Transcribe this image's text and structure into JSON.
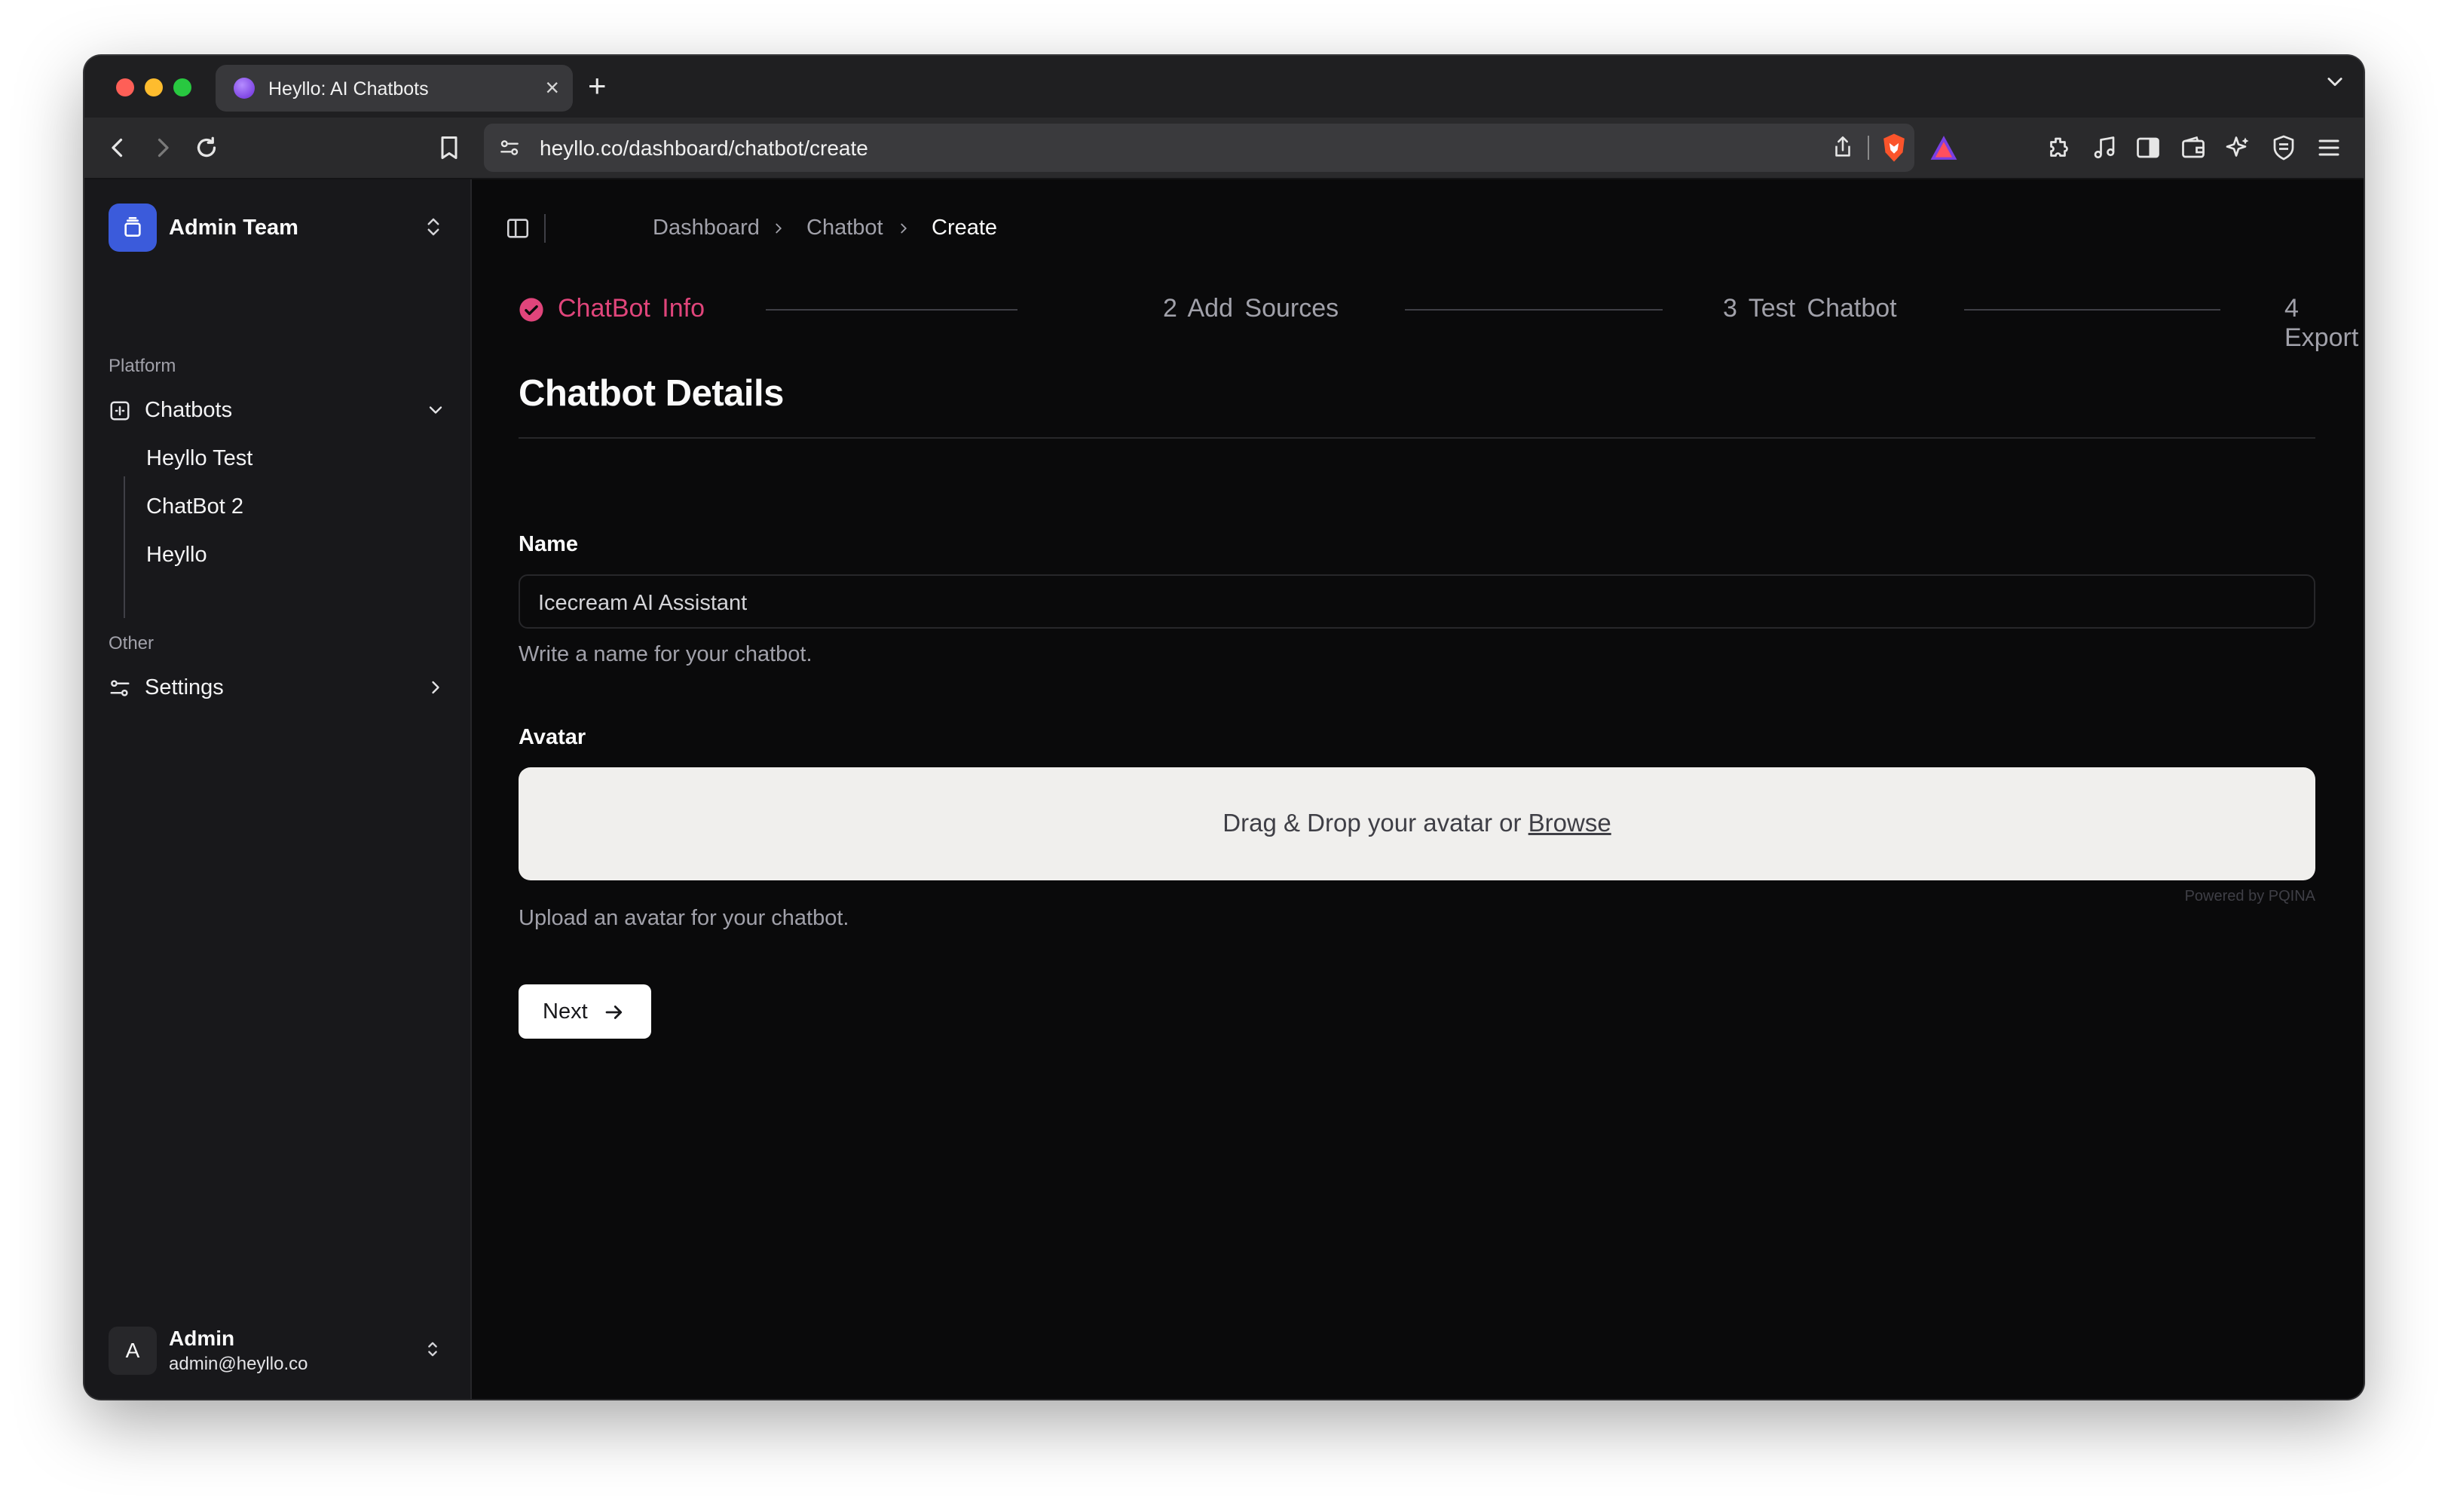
{
  "browser": {
    "tab_title": "Heyllo: AI Chatbots",
    "tab_close": "×",
    "new_tab": "+",
    "url": "heyllo.co/dashboard/chatbot/create"
  },
  "sidebar": {
    "team_name": "Admin Team",
    "platform_label": "Platform",
    "chatbots_label": "Chatbots",
    "chatbot_items": [
      {
        "label": "Heyllo Test"
      },
      {
        "label": "ChatBot 2"
      },
      {
        "label": "Heyllo"
      }
    ],
    "other_label": "Other",
    "settings_label": "Settings",
    "user": {
      "initial": "A",
      "name": "Admin",
      "email": "admin@heyllo.co"
    }
  },
  "breadcrumb": {
    "items": [
      "Dashboard",
      "Chatbot"
    ],
    "current": "Create"
  },
  "steps": [
    {
      "label": "ChatBot  Info",
      "state": "complete"
    },
    {
      "label": "2  Add  Sources",
      "state": "pending"
    },
    {
      "label": "3  Test  Chatbot",
      "state": "pending"
    },
    {
      "label": "4  Export",
      "state": "pending"
    }
  ],
  "form": {
    "heading": "Chatbot Details",
    "name_label": "Name",
    "name_value": "Icecream AI Assistant",
    "name_help": "Write a name for your chatbot.",
    "avatar_label": "Avatar",
    "dropzone_text": "Drag & Drop your avatar or ",
    "dropzone_link": "Browse",
    "powered_by": "Powered by PQINA",
    "avatar_help": "Upload an avatar for your chatbot.",
    "next_label": "Next"
  },
  "colors": {
    "accent_step": "#e0457b",
    "team_logo": "#3b5bdb",
    "background": "#0a0a0b",
    "sidebar": "#18181b"
  }
}
